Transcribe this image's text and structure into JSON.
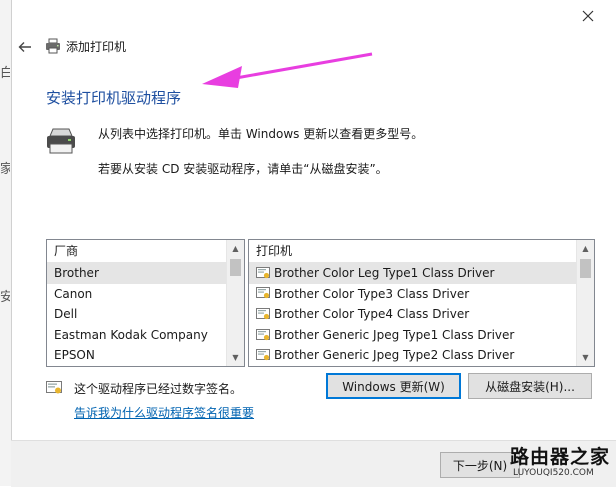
{
  "background_edge": {
    "glyphs": [
      "白",
      "家",
      "安"
    ]
  },
  "window": {
    "title": "添加打印机"
  },
  "page": {
    "heading": "安装打印机驱动程序",
    "description_line1": "从列表中选择打印机。单击 Windows 更新以查看更多型号。",
    "description_line2": "若要从安装 CD 安装驱动程序，请单击“从磁盘安装”。"
  },
  "manufacturers": {
    "header": "厂商",
    "items": [
      "Brother",
      "Canon",
      "Dell",
      "Eastman Kodak Company",
      "EPSON"
    ],
    "selected": "Brother"
  },
  "printers": {
    "header": "打印机",
    "items": [
      "Brother Color Leg Type1 Class Driver",
      "Brother Color Type3 Class Driver",
      "Brother Color Type4 Class Driver",
      "Brother Generic Jpeg Type1 Class Driver",
      "Brother Generic Jpeg Type2 Class Driver"
    ],
    "selected": "Brother Color Leg Type1 Class Driver"
  },
  "signature": {
    "status_text": "这个驱动程序已经过数字签名。",
    "link_text": "告诉我为什么驱动程序签名很重要"
  },
  "buttons": {
    "windows_update": "Windows 更新(W)",
    "have_disk": "从磁盘安装(H)...",
    "next": "下一步(N)"
  },
  "watermark": {
    "name": "路由器之家",
    "url": "LUYOUQI520.COM"
  },
  "colors": {
    "heading": "#1e4fa0",
    "link": "#0063b1",
    "annotation_arrow": "#e83ee0",
    "focus_border": "#0078d7",
    "selection": "#e5e5e5"
  }
}
